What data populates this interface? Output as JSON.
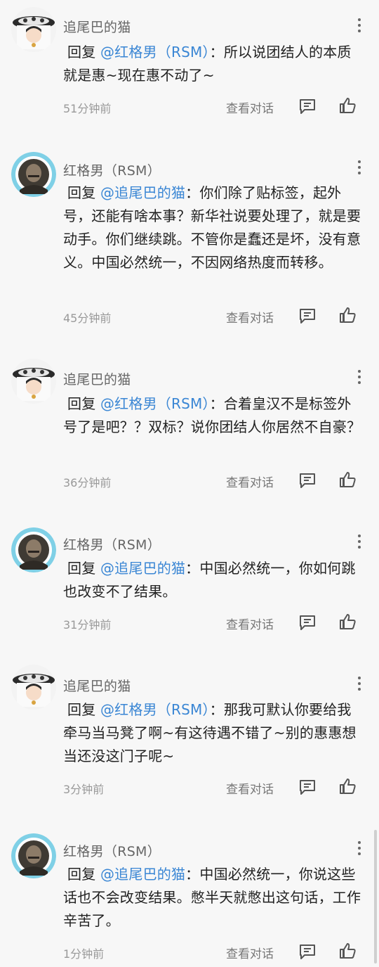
{
  "comments": [
    {
      "user": "追尾巴的猫",
      "avatar": "cat-girl-avatar",
      "reply_label": "回复",
      "mention": "@红格男（RSM）",
      "sep": "：",
      "text": "所以说团结人的本质就是惠~现在惠不动了~",
      "time": "51分钟前",
      "view_convo": "查看对话"
    },
    {
      "user": "红格男（RSM）",
      "avatar": "portrait-avatar",
      "reply_label": "回复",
      "mention": "@追尾巴的猫",
      "sep": "：",
      "text": "你们除了贴标签，起外号，还能有啥本事？新华社说要处理了，就是要动手。你们继续跳。不管你是蠢还是坏，没有意义。中国必然统一，不因网络热度而转移。",
      "time": "45分钟前",
      "view_convo": "查看对话"
    },
    {
      "user": "追尾巴的猫",
      "avatar": "cat-girl-avatar",
      "reply_label": "回复",
      "mention": "@红格男（RSM）",
      "sep": "：",
      "text": "合着皇汉不是标签外号了是吧？？双标？说你团结人你居然不自豪？",
      "time": "36分钟前",
      "view_convo": "查看对话"
    },
    {
      "user": "红格男（RSM）",
      "avatar": "portrait-avatar",
      "reply_label": "回复",
      "mention": "@追尾巴的猫",
      "sep": "：",
      "text": "中国必然统一，你如何跳也改变不了结果。",
      "time": "31分钟前",
      "view_convo": "查看对话"
    },
    {
      "user": "追尾巴的猫",
      "avatar": "cat-girl-avatar",
      "reply_label": "回复",
      "mention": "@红格男（RSM）",
      "sep": "：",
      "text": "那我可默认你要给我牵马当马凳了啊~有这待遇不错了~别的惠惠想当还没这门子呢~",
      "time": "3分钟前",
      "view_convo": "查看对话"
    },
    {
      "user": "红格男（RSM）",
      "avatar": "portrait-avatar",
      "reply_label": "回复",
      "mention": "@追尾巴的猫",
      "sep": "：",
      "text": "中国必然统一，你说这些话也不会改变结果。憋半天就憋出这句话，工作辛苦了。",
      "time": "1分钟前",
      "view_convo": "查看对话"
    }
  ]
}
